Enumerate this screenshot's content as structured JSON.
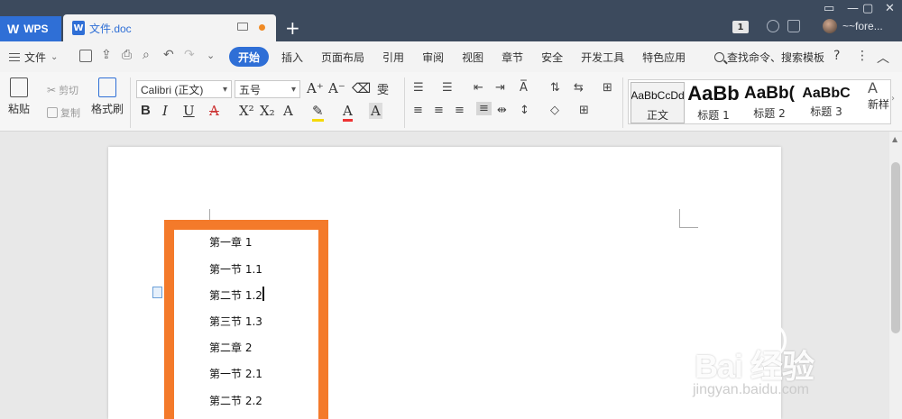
{
  "titlebar": {
    "app_name": "WPS",
    "doc_tab": "文件.doc",
    "badge": "1",
    "username": "~~fore..."
  },
  "menubar": {
    "file_label": "文件",
    "tabs": [
      "开始",
      "插入",
      "页面布局",
      "引用",
      "审阅",
      "视图",
      "章节",
      "安全",
      "开发工具",
      "特色应用"
    ],
    "active_tab": "开始",
    "search_label": "查找命令、搜索模板"
  },
  "ribbon": {
    "paste": "粘贴",
    "cut": "剪切",
    "copy": "复制",
    "format_painter": "格式刷",
    "font_name": "Calibri (正文)",
    "font_size": "五号",
    "styles": [
      {
        "sample": "AaBbCcDd",
        "name": "正文"
      },
      {
        "sample": "AaBb",
        "name": "标题 1"
      },
      {
        "sample": "AaBb(",
        "name": "标题 2"
      },
      {
        "sample": "AaBbC",
        "name": "标题 3"
      }
    ],
    "new_style": "新样"
  },
  "document": {
    "lines": [
      "第一章 1",
      "第一节 1.1",
      "第二节 1.2",
      "第三节 1.3",
      "第二章 2",
      "第一节 2.1",
      "第二节 2.2"
    ]
  },
  "watermark": {
    "brand": "Bai  经验",
    "url": "jingyan.baidu.com"
  },
  "colors": {
    "accent": "#2f6fd6",
    "highlight": "#f47a2a",
    "titlebar": "#3c4a5d"
  }
}
